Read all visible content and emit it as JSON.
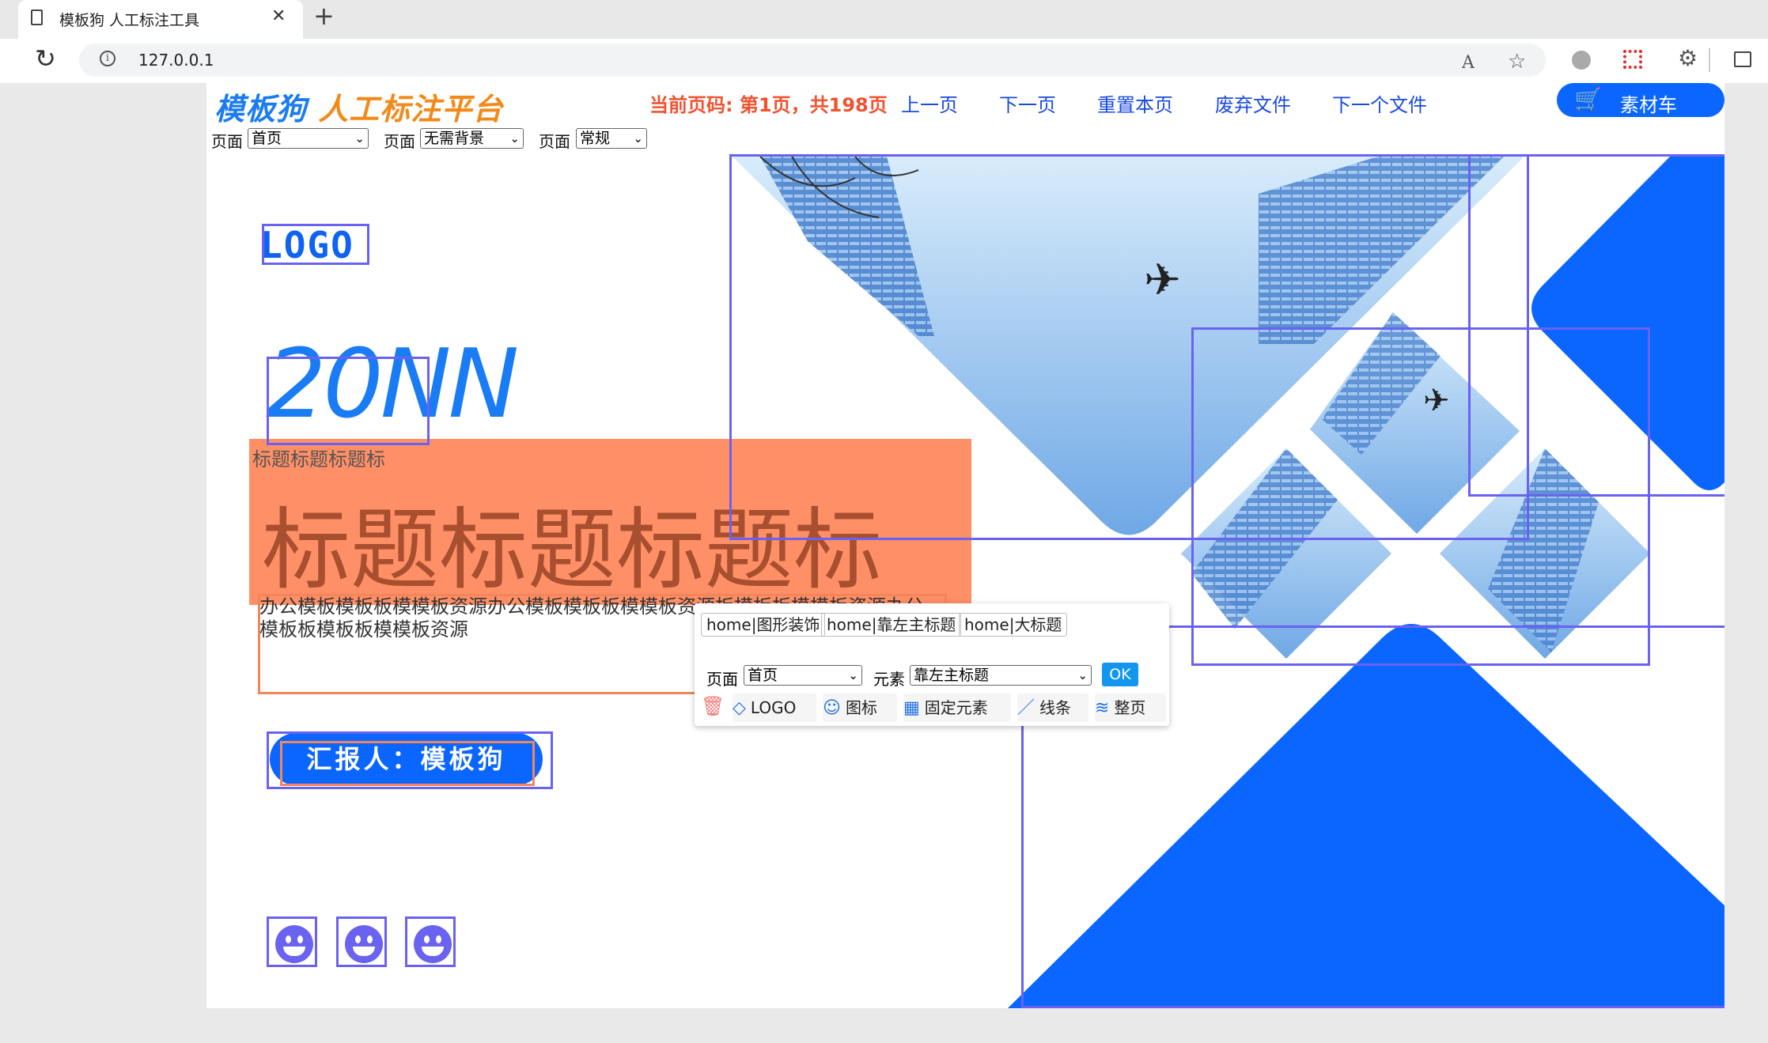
{
  "browser": {
    "tab_title": "模板狗 人工标注工具",
    "new_tab": "+",
    "close_tab": "✕",
    "url": "127.0.0.1"
  },
  "header": {
    "logo_part1": "模板狗",
    "logo_part2": "人工标注平台",
    "page_indicator": "当前页码: 第1页，共198页",
    "nav": [
      "上一页",
      "下一页",
      "重置本页",
      "废弃文件",
      "下一个文件"
    ],
    "cart_label": "素材车"
  },
  "filters": [
    {
      "label": "页面",
      "value": "首页"
    },
    {
      "label": "页面",
      "value": "无需背景"
    },
    {
      "label": "页面",
      "value": "常规"
    }
  ],
  "slide": {
    "logo": "LOGO",
    "year": "20NN",
    "subtitle_small": "标题标题标题标",
    "title_large": "标题标题标题标",
    "body_text": "办公模板模板板模模板资源办公模板模板板模模板资源板模板板模模板资源办公模板板模板板模模板资源",
    "cta": "汇报人：模板狗"
  },
  "popup": {
    "chips": [
      "home|图形装饰",
      "home|靠左主标题",
      "home|大标题"
    ],
    "page_label": "页面",
    "page_value": "首页",
    "element_label": "元素",
    "element_value": "靠左主标题",
    "ok": "OK",
    "buttons": [
      "LOGO",
      "图标",
      "固定元素",
      "线条",
      "整页"
    ]
  },
  "colors": {
    "accent": "#0a66ff",
    "annotation_box": "#6a62f0",
    "highlight": "#ff8f66",
    "page_indicator": "#f0532f"
  }
}
